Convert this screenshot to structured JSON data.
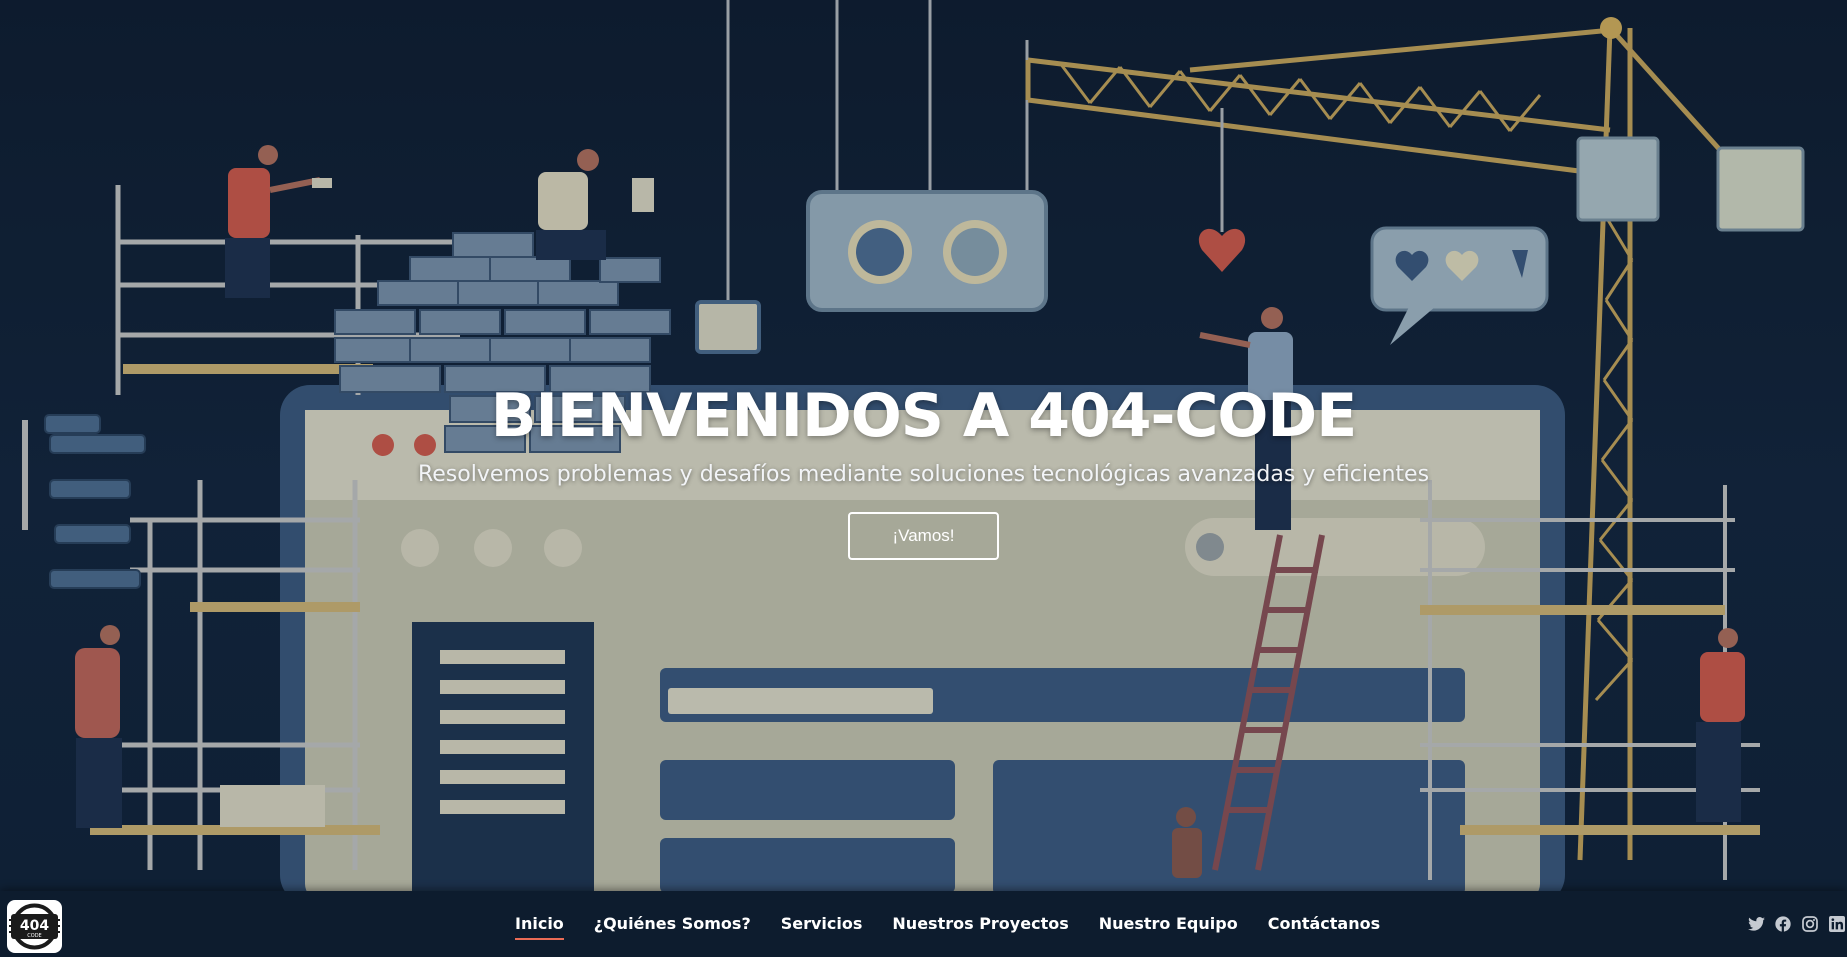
{
  "hero": {
    "title": "BIENVENIDOS A 404-CODE",
    "subtitle": "Resolvemos problemas y desafíos mediante soluciones tecnológicas avanzadas y eficientes",
    "cta_label": "¡Vamos!"
  },
  "brand": {
    "logo_text": "404",
    "logo_sub": "CODE"
  },
  "nav": {
    "items": [
      {
        "label": "Inicio",
        "active": true
      },
      {
        "label": "¿Quiénes Somos?",
        "active": false
      },
      {
        "label": "Servicios",
        "active": false
      },
      {
        "label": "Nuestros Proyectos",
        "active": false
      },
      {
        "label": "Nuestro Equipo",
        "active": false
      },
      {
        "label": "Contáctanos",
        "active": false
      }
    ]
  },
  "social": [
    "twitter-icon",
    "facebook-icon",
    "instagram-icon",
    "linkedin-icon"
  ],
  "colors": {
    "background": "#0f1f33",
    "navbar": "#0d1c2e",
    "active_underline": "#e96b56",
    "crane": "#c9a85c",
    "accent_red": "#d25b4c"
  }
}
